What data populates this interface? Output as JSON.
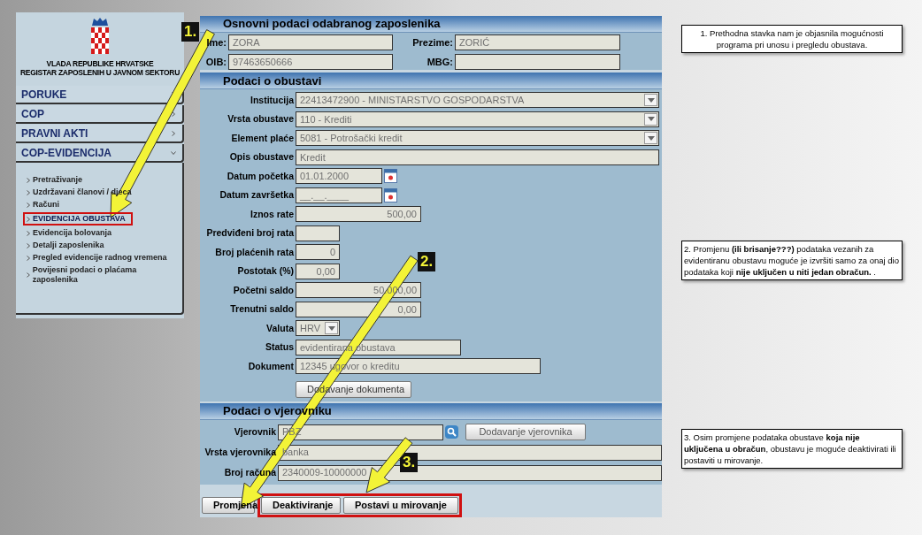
{
  "sidebar": {
    "logo_lines": [
      "VLADA REPUBLIKE HRVATSKE",
      "REGISTAR ZAPOSLENIH U JAVNOM SEKTORU"
    ],
    "menu": [
      {
        "label": "PORUKE",
        "expanded": false
      },
      {
        "label": "COP",
        "expanded": false
      },
      {
        "label": "PRAVNI AKTI",
        "expanded": false
      },
      {
        "label": "COP-EVIDENCIJA",
        "expanded": true,
        "children": [
          {
            "label": "Pretraživanje",
            "selected": false,
            "highlighted": false
          },
          {
            "label": "Uzdržavani članovi / djeca",
            "selected": false,
            "highlighted": false
          },
          {
            "label": "Računi",
            "selected": false,
            "highlighted": false
          },
          {
            "label": "EVIDENCIJA OBUSTAVA",
            "selected": true,
            "highlighted": true
          },
          {
            "label": "Evidencija bolovanja",
            "selected": false,
            "highlighted": false
          },
          {
            "label": "Detalji zaposlenika",
            "selected": false,
            "highlighted": false
          },
          {
            "label": "Pregled evidencije radnog vremena",
            "selected": false,
            "highlighted": false
          },
          {
            "label": "Povijesni podaci o plaćama zaposlenika",
            "selected": false,
            "highlighted": false
          }
        ]
      }
    ]
  },
  "employee": {
    "title": "Osnovni podaci odabranog zaposlenika",
    "fields": [
      {
        "label": "Ime:",
        "value": "ZORA"
      },
      {
        "label": "Prezime:",
        "value": "ZORIĆ"
      },
      {
        "label": "OIB:",
        "value": "97463650666"
      },
      {
        "label": "MBG:"
      }
    ]
  },
  "deduction": {
    "title": "Podaci o obustavi",
    "rows": [
      {
        "label": "Institucija",
        "kind": "select",
        "value": "22413472900 - MINISTARSTVO GOSPODARSTVA"
      },
      {
        "label": "Vrsta obustave",
        "kind": "select",
        "value": "110 - Krediti"
      },
      {
        "label": "Element plaće",
        "kind": "select",
        "value": "5081 - Potrošački kredit"
      },
      {
        "label": "Opis obustave",
        "kind": "text",
        "value": "Kredit"
      },
      {
        "label": "Datum početka",
        "kind": "date",
        "value": "01.01.2000"
      },
      {
        "label": "Datum završetka",
        "kind": "date",
        "value": "__.__.____"
      },
      {
        "label": "Iznos rate",
        "kind": "amount",
        "value": "500,00"
      },
      {
        "label": "Predviđeni broj rata",
        "kind": "count"
      },
      {
        "label": "Broj plaćenih rata",
        "kind": "count",
        "value": "0"
      },
      {
        "label": "Postotak (%)",
        "kind": "count",
        "value": "0,00"
      },
      {
        "label": "Početni saldo",
        "kind": "amount",
        "value": "50.000,00"
      },
      {
        "label": "Trenutni saldo",
        "kind": "amount",
        "value": "0,00"
      },
      {
        "label": "Valuta",
        "kind": "currency",
        "value": "HRV"
      },
      {
        "label": "Status",
        "kind": "status",
        "value": "evidentirana obustava"
      },
      {
        "label": "Dokument",
        "kind": "document",
        "value": "12345 ugovor o kreditu"
      }
    ],
    "button": "Dodavanje dokumenta"
  },
  "creditor": {
    "title": "Podaci o vjerovniku",
    "rows": [
      {
        "label": "Vjerovnik",
        "kind": "lookup",
        "value": "PBZ"
      },
      {
        "label": "Vrsta vjerovnika",
        "kind": "text",
        "value": "banka"
      },
      {
        "label": "Broj računa",
        "kind": "text",
        "value": "2340009-10000000"
      }
    ],
    "button": "Dodavanje vjerovnika"
  },
  "actions": [
    {
      "label": "Promjena",
      "highlighted": false
    },
    {
      "label": "Deaktiviranje",
      "highlighted": true
    },
    {
      "label": "Postavi u mirovanje",
      "highlighted": true
    }
  ],
  "annotations": [
    {
      "label": "1."
    },
    {
      "label": "2."
    },
    {
      "label": "3."
    }
  ],
  "notes": [
    "1. Prethodna stavka nam je objasnila mogućnosti programa pri unosu i pregledu obustava.",
    "2.  Promjenu **(ili brisanje???)** podataka vezanih za evidentiranu obustavu moguće je izvršiti samo za onaj dio podataka koji **nije uključen u niti jedan obračun.** .",
    "3. Osim promjene podataka obustave **koja nije uključena u obračun**, obustavu je moguće deaktivirati ili postaviti u mirovanje."
  ]
}
